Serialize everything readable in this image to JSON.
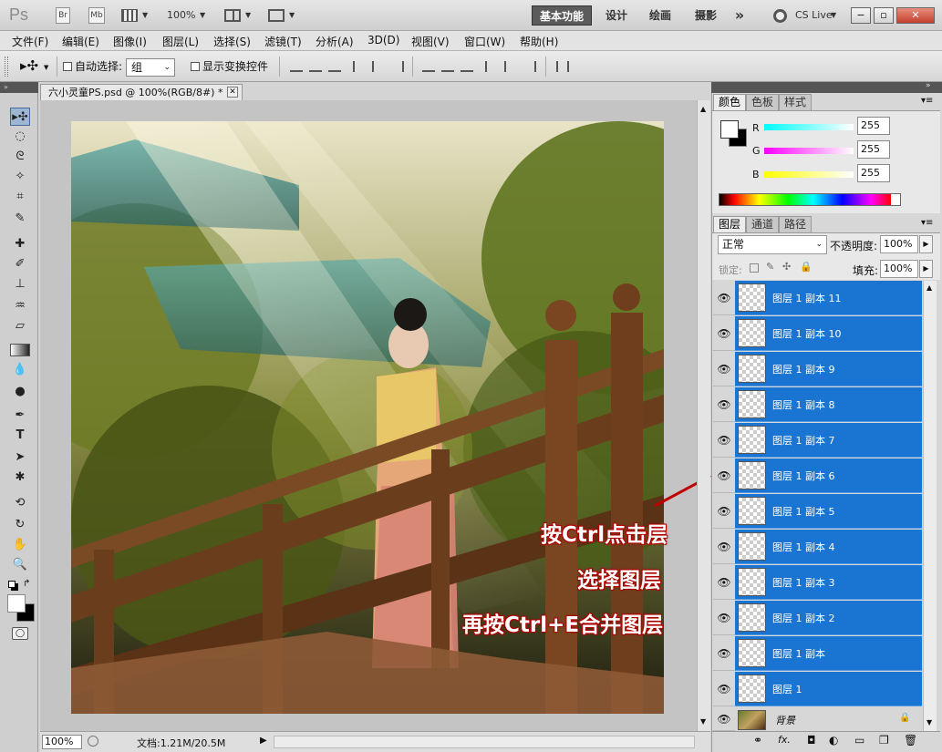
{
  "titlebar": {
    "logo": "Ps",
    "br": "Br",
    "mb": "Mb",
    "zoom": "100%",
    "workspaces": [
      "基本功能",
      "设计",
      "绘画",
      "摄影"
    ],
    "more": "»",
    "cs_live": "CS Live"
  },
  "menu": [
    "文件(F)",
    "编辑(E)",
    "图像(I)",
    "图层(L)",
    "选择(S)",
    "滤镜(T)",
    "分析(A)",
    "3D(D)",
    "视图(V)",
    "窗口(W)",
    "帮助(H)"
  ],
  "options": {
    "auto_select_label": "自动选择:",
    "auto_select_value": "组",
    "show_transform_label": "显示变换控件"
  },
  "document": {
    "tab_title": "六小灵童PS.psd @ 100%(RGB/8#) *",
    "zoom": "100%",
    "doc_info": "文档:1.21M/20.5M"
  },
  "color_panel": {
    "tabs": [
      "颜色",
      "色板",
      "样式"
    ],
    "channels": [
      {
        "label": "R",
        "value": "255"
      },
      {
        "label": "G",
        "value": "255"
      },
      {
        "label": "B",
        "value": "255"
      }
    ]
  },
  "layers_panel": {
    "tabs": [
      "图层",
      "通道",
      "路径"
    ],
    "blend_mode": "正常",
    "opacity_label": "不透明度:",
    "opacity_value": "100%",
    "lock_label": "锁定:",
    "fill_label": "填充:",
    "fill_value": "100%",
    "layers": [
      "图层 1 副本 11",
      "图层 1 副本 10",
      "图层 1 副本 9",
      "图层 1 副本 8",
      "图层 1 副本 7",
      "图层 1 副本 6",
      "图层 1 副本 5",
      "图层 1 副本 4",
      "图层 1 副本 3",
      "图层 1 副本 2",
      "图层 1 副本",
      "图层 1"
    ],
    "background_layer": "背景"
  },
  "annotation": {
    "line1": "按Ctrl点击层",
    "line2": "选择图层",
    "line3": "再按Ctrl+E合并图层",
    "color": "#c00000"
  },
  "colors": {
    "selection_blue": "#1a74d1",
    "panel_gray": "#d7d7d7"
  }
}
